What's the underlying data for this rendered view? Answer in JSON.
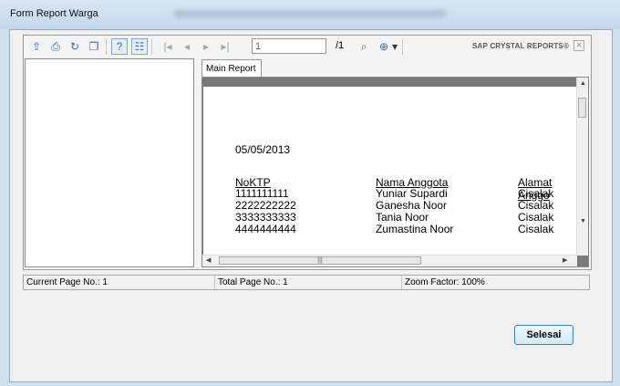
{
  "window": {
    "title": "Form Report Warga"
  },
  "toolbar": {
    "icons": [
      "export-icon",
      "print-icon",
      "refresh-icon",
      "copy-icon",
      "help-icon",
      "group-tree-toggle-icon",
      "first-page-icon",
      "previous-page-icon",
      "next-page-icon",
      "last-page-icon",
      "find-icon",
      "zoom-icon"
    ],
    "page_value": "1",
    "page_total": "/1",
    "brand": "SAP CRYSTAL REPORTS®",
    "zoom_caret": "▾"
  },
  "tabs": {
    "main": "Main Report"
  },
  "report": {
    "date": "05/05/2013",
    "columns": [
      "NoKTP",
      "Nama Anggota",
      "Alamat Anggo"
    ],
    "rows": [
      [
        "1111111111",
        "Yuniar Supardi",
        "Cisalak"
      ],
      [
        "2222222222",
        "Ganesha Noor",
        "Cisalak"
      ],
      [
        "3333333333",
        "Tania Noor",
        "Cisalak"
      ],
      [
        "4444444444",
        "Zumastina Noor",
        "Cisalak"
      ]
    ]
  },
  "status": {
    "current_page": "Current Page No.: 1",
    "total_page": "Total Page No.: 1",
    "zoom": "Zoom Factor: 100%"
  },
  "buttons": {
    "selesai": "Selesai"
  }
}
